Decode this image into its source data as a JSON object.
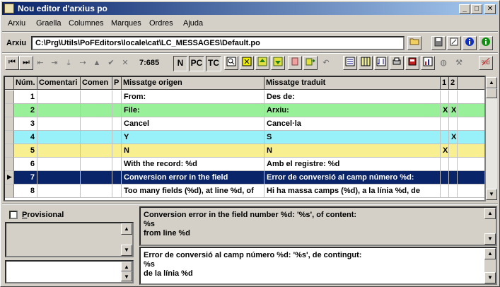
{
  "window": {
    "title": "Nou editor d'arxius po"
  },
  "title_buttons": {
    "minimize": "_",
    "maximize": "□",
    "close": "✕"
  },
  "menu": [
    "Arxiu",
    "Graella",
    "Columnes",
    "Marques",
    "Ordres",
    "Ajuda"
  ],
  "file": {
    "label": "Arxiu",
    "path": "C:\\Prg\\Utils\\PoFEditors\\locale\\cat\\LC_MESSAGES\\Default.po"
  },
  "toolbar": {
    "counter": "7:685",
    "toggle_n": "N",
    "toggle_pc": "PC",
    "toggle_tc": "TC"
  },
  "grid": {
    "columns": [
      "Núm.",
      "Comentari",
      "Comen",
      "P",
      "Missatge origen",
      "Missatge traduit",
      "1",
      "2"
    ],
    "rows": [
      {
        "num": "1",
        "origen": "From:",
        "traduit": "Des de:",
        "c1": "",
        "c2": "",
        "bg": "#ffffff",
        "fg": "#000000",
        "indicator": ""
      },
      {
        "num": "2",
        "origen": "File:",
        "traduit": "Arxiu:",
        "c1": "X",
        "c2": "X",
        "bg": "#98f098",
        "fg": "#000000",
        "indicator": ""
      },
      {
        "num": "3",
        "origen": "Cancel",
        "traduit": "Cancel·la",
        "c1": "",
        "c2": "",
        "bg": "#ffffff",
        "fg": "#000000",
        "indicator": ""
      },
      {
        "num": "4",
        "origen": "Y",
        "traduit": "S",
        "c1": "",
        "c2": "X",
        "bg": "#98f0f8",
        "fg": "#000000",
        "indicator": ""
      },
      {
        "num": "5",
        "origen": "N",
        "traduit": "N",
        "c1": "X",
        "c2": "",
        "bg": "#f8f090",
        "fg": "#000000",
        "indicator": ""
      },
      {
        "num": "6",
        "origen": "With the record: %d",
        "traduit": "Amb el registre: %d",
        "c1": "",
        "c2": "",
        "bg": "#ffffff",
        "fg": "#000000",
        "indicator": ""
      },
      {
        "num": "7",
        "origen": "Conversion error in the field",
        "traduit": "Error de conversió al camp número %d:",
        "c1": "",
        "c2": "",
        "bg": "#0a246a",
        "fg": "#ffffff",
        "indicator": "▶"
      },
      {
        "num": "8",
        "origen": "Too many fields (%d), at line %d, of",
        "traduit": "Hi ha massa camps (%d), a la línia %d, de",
        "c1": "",
        "c2": "",
        "bg": "#ffffff",
        "fg": "#000000",
        "indicator": ""
      }
    ]
  },
  "provisional": {
    "label": "Provisional",
    "checked": false
  },
  "source_text": "Conversion error in the field number %d: '%s', of content:\n%s\nfrom line %d",
  "translation_text": "Error de conversió al camp número %d: '%s', de contingut:\n%s\nde la línia %d",
  "colors": {
    "selection": "#0a246a",
    "green": "#98f098",
    "cyan": "#98f0f8",
    "yellow": "#f8f090"
  }
}
